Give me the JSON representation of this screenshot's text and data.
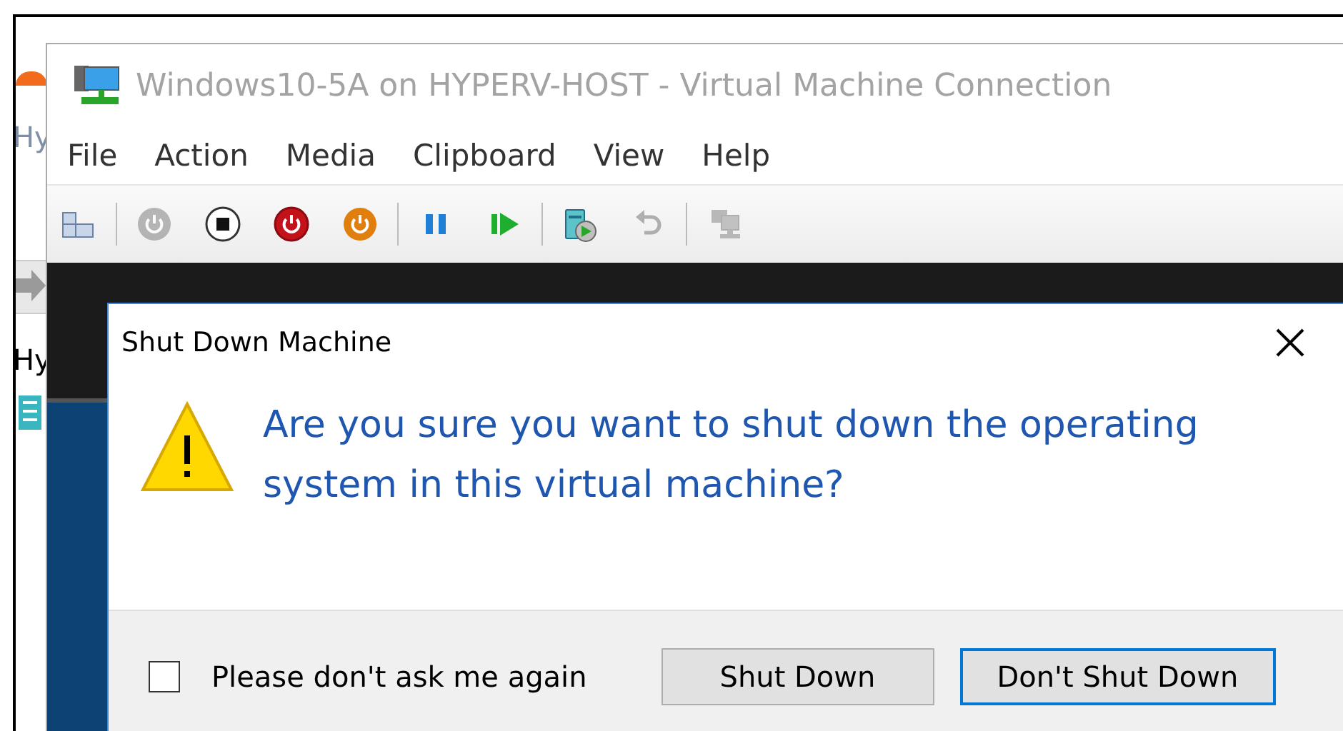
{
  "background_window": {
    "labels": [
      "Hy",
      "Hy"
    ]
  },
  "vm_window": {
    "title": "Windows10-5A on HYPERV-HOST - Virtual Machine Connection",
    "menu": [
      "File",
      "Action",
      "Media",
      "Clipboard",
      "View",
      "Help"
    ],
    "toolbar_groups": [
      [
        {
          "kind": "settings",
          "disabled": false
        }
      ],
      [
        {
          "kind": "start",
          "disabled": true
        },
        {
          "kind": "turn-off",
          "disabled": false
        },
        {
          "kind": "shut-down",
          "disabled": false
        },
        {
          "kind": "save",
          "disabled": false
        }
      ],
      [
        {
          "kind": "pause",
          "disabled": false
        },
        {
          "kind": "reset",
          "disabled": false
        }
      ],
      [
        {
          "kind": "checkpoint",
          "disabled": false
        },
        {
          "kind": "revert",
          "disabled": true
        }
      ],
      [
        {
          "kind": "enhanced-session",
          "disabled": true
        }
      ]
    ]
  },
  "dialog": {
    "title": "Shut Down Machine",
    "message": "Are you sure you want to shut down the operating system in this virtual machine?",
    "checkbox": {
      "label": "Please don't ask me again",
      "checked": false
    },
    "buttons": [
      {
        "label": "Shut Down",
        "default": false
      },
      {
        "label": "Don't Shut Down",
        "default": true
      }
    ]
  }
}
